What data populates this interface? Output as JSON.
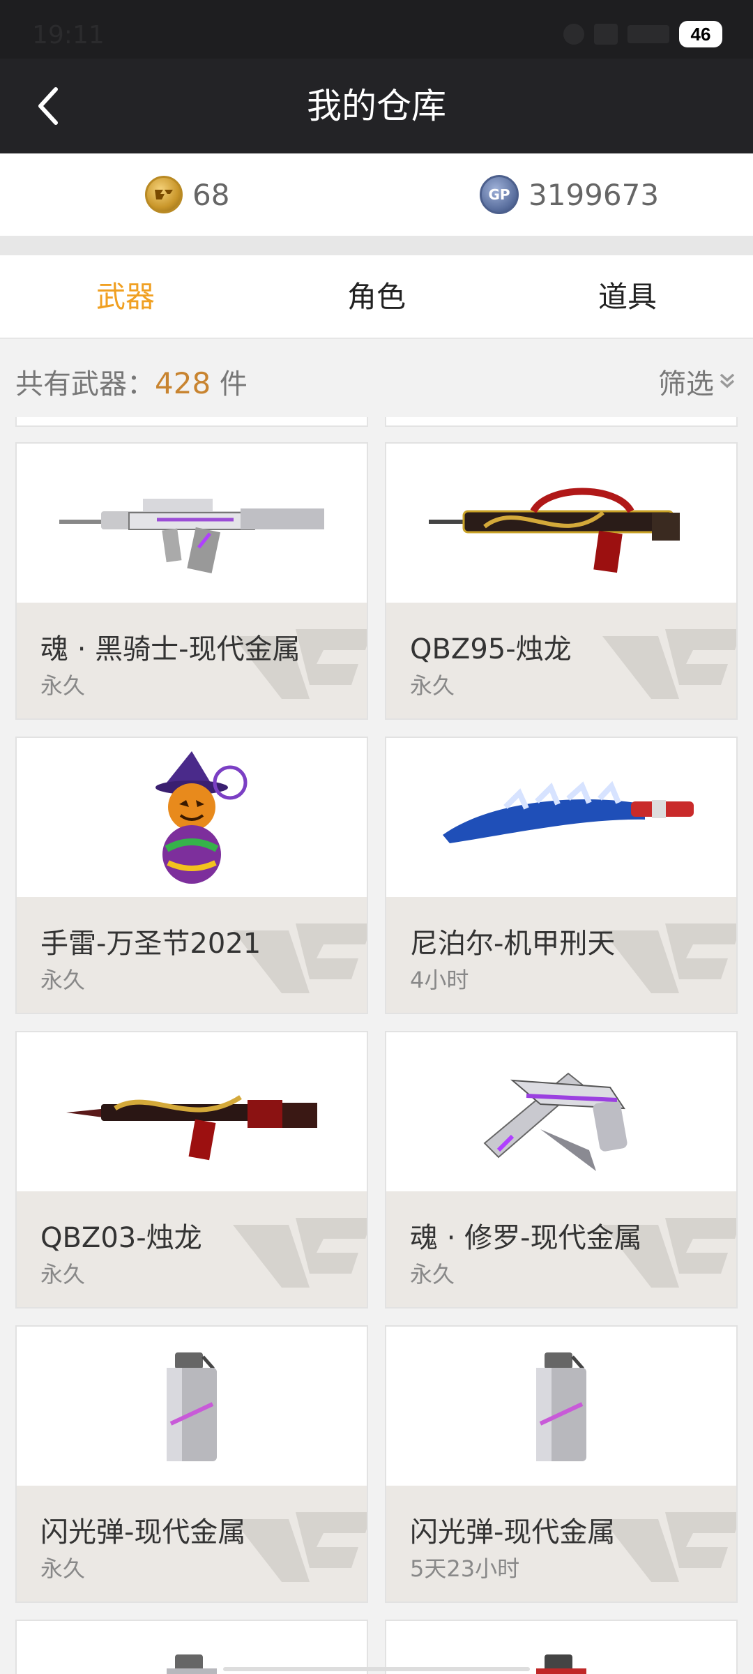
{
  "status": {
    "time": "19:11",
    "battery": "46"
  },
  "nav": {
    "title": "我的仓库",
    "back_icon": "chevron-left-icon"
  },
  "currency": {
    "cf_coin_icon": "cf-coin-icon",
    "cf_amount": "68",
    "gp_coin_icon": "gp-coin-icon",
    "gp_label": "GP",
    "gp_amount": "3199673"
  },
  "tabs": [
    {
      "label": "武器",
      "active": true
    },
    {
      "label": "角色",
      "active": false
    },
    {
      "label": "道具",
      "active": false
    }
  ],
  "summary": {
    "prefix": "共有武器：",
    "count": "428",
    "suffix": " 件",
    "filter_label": "筛选"
  },
  "items": [
    {
      "name": "魂 · 黑骑士-现代金属",
      "duration": "永久",
      "icon": "rifle-icon"
    },
    {
      "name": "QBZ95-烛龙",
      "duration": "永久",
      "icon": "rifle-icon"
    },
    {
      "name": "手雷-万圣节2021",
      "duration": "永久",
      "icon": "grenade-icon"
    },
    {
      "name": "尼泊尔-机甲刑天",
      "duration": "4小时",
      "icon": "knife-icon"
    },
    {
      "name": "QBZ03-烛龙",
      "duration": "永久",
      "icon": "rifle-icon"
    },
    {
      "name": "魂 · 修罗-现代金属",
      "duration": "永久",
      "icon": "pistol-icon"
    },
    {
      "name": "闪光弹-现代金属",
      "duration": "永久",
      "icon": "flashbang-icon"
    },
    {
      "name": "闪光弹-现代金属",
      "duration": "5天23小时",
      "icon": "flashbang-icon"
    }
  ],
  "colors": {
    "accent": "#f0a022",
    "nav_bg": "#232326",
    "count_color": "#c88430"
  }
}
